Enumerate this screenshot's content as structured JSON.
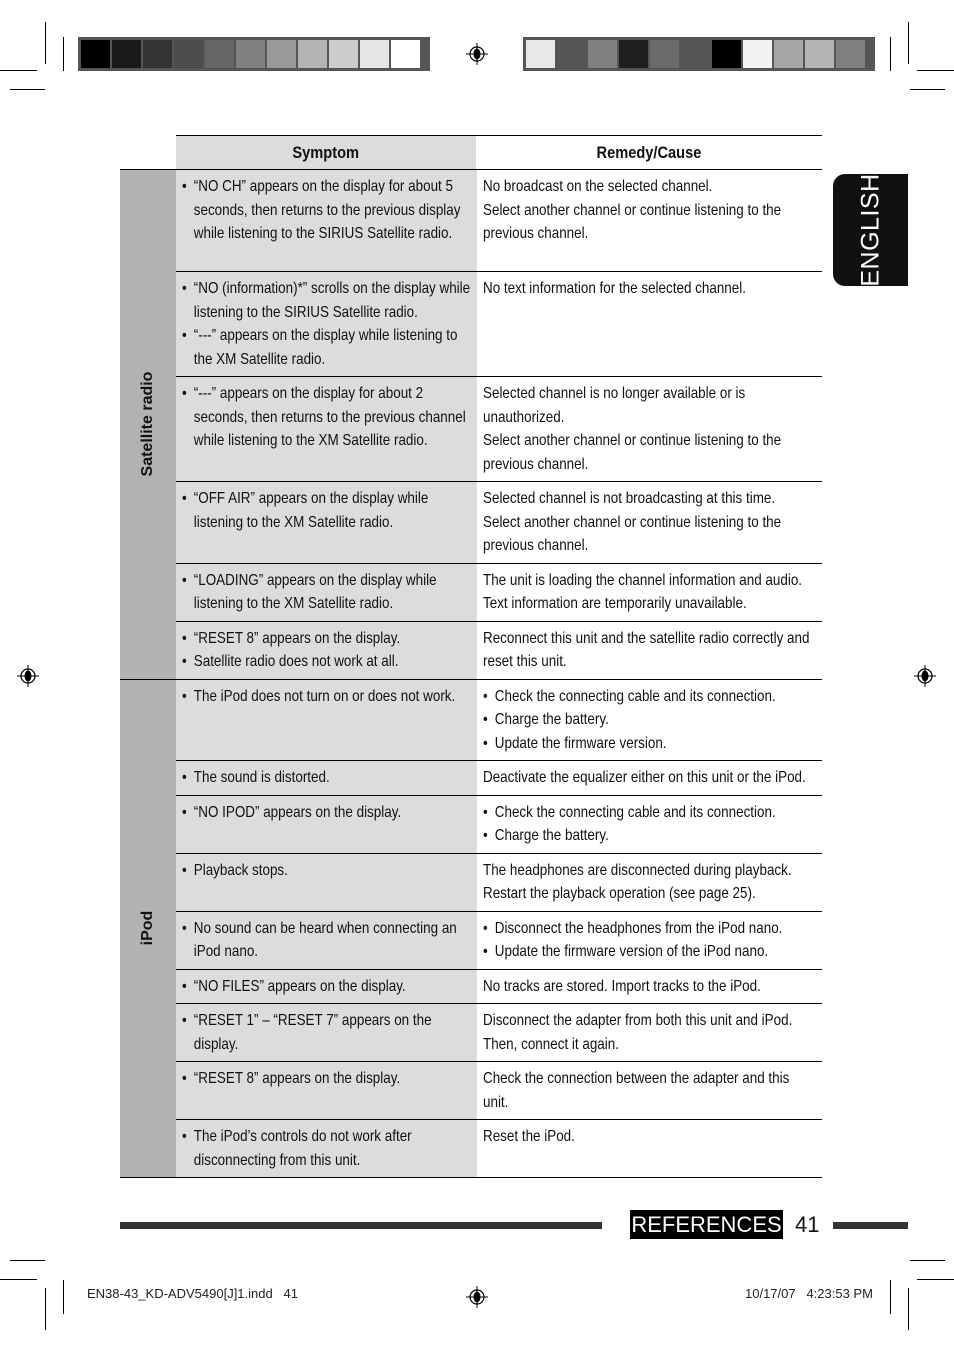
{
  "language_tab": "ENGLISH",
  "table": {
    "headers": {
      "symptom": "Symptom",
      "remedy": "Remedy/Cause"
    },
    "groups": [
      {
        "category": "Satellite radio",
        "rows": [
          {
            "symptom": [
              "“NO CH” appears on the display for about 5 seconds, then returns to the previous display while listening to the SIRIUS Satellite radio."
            ],
            "remedy": {
              "bulleted": false,
              "lines": [
                "No broadcast on the selected channel.",
                "Select another channel or continue listening to the previous channel."
              ]
            }
          },
          {
            "symptom": [
              "“NO (information)*” scrolls on the display while listening to the SIRIUS Satellite radio.",
              "“---” appears on the display while listening to the XM Satellite radio."
            ],
            "remedy": {
              "bulleted": false,
              "lines": [
                "No text information for the selected channel."
              ]
            }
          },
          {
            "symptom": [
              "“---” appears on the display for about 2 seconds, then returns to the previous channel while listening to the XM Satellite radio."
            ],
            "remedy": {
              "bulleted": false,
              "lines": [
                "Selected channel is no longer available or is unauthorized.",
                "Select another channel or continue listening to the previous channel."
              ]
            }
          },
          {
            "symptom": [
              "“OFF AIR” appears on the display while listening to the XM Satellite radio."
            ],
            "remedy": {
              "bulleted": false,
              "lines": [
                "Selected channel is not broadcasting at this time.",
                "Select another channel or continue listening to the previous channel."
              ]
            }
          },
          {
            "symptom": [
              "“LOADING” appears on the display while listening to the XM Satellite radio."
            ],
            "remedy": {
              "bulleted": false,
              "lines": [
                "The unit is loading the channel information and audio.",
                "Text information are temporarily unavailable."
              ]
            }
          },
          {
            "symptom": [
              "“RESET 8” appears on the display.",
              "Satellite radio does not work at all."
            ],
            "remedy": {
              "bulleted": false,
              "lines": [
                "Reconnect this unit and the satellite radio correctly and reset this unit."
              ]
            }
          }
        ]
      },
      {
        "category": "iPod",
        "rows": [
          {
            "symptom": [
              "The iPod does not turn on or does not work."
            ],
            "remedy": {
              "bulleted": true,
              "lines": [
                "Check the connecting cable and its connection.",
                "Charge the battery.",
                "Update the firmware version."
              ]
            }
          },
          {
            "symptom": [
              "The sound is distorted."
            ],
            "remedy": {
              "bulleted": false,
              "lines": [
                "Deactivate the equalizer either on this unit or the iPod."
              ]
            }
          },
          {
            "symptom": [
              "“NO IPOD” appears on the display."
            ],
            "remedy": {
              "bulleted": true,
              "lines": [
                "Check the connecting cable and its connection.",
                "Charge the battery."
              ]
            }
          },
          {
            "symptom": [
              "Playback stops."
            ],
            "remedy": {
              "bulleted": false,
              "lines": [
                "The headphones are disconnected during playback.",
                "Restart the playback operation (see page 25)."
              ]
            }
          },
          {
            "symptom": [
              "No sound can be heard when connecting an iPod nano."
            ],
            "remedy": {
              "bulleted": true,
              "lines": [
                "Disconnect the headphones from the iPod nano.",
                "Update the firmware version of the iPod nano."
              ]
            }
          },
          {
            "symptom": [
              "“NO FILES” appears on the display."
            ],
            "remedy": {
              "bulleted": false,
              "lines": [
                "No tracks are stored. Import tracks to the iPod."
              ]
            }
          },
          {
            "symptom": [
              "“RESET 1” – “RESET 7” appears on the display."
            ],
            "remedy": {
              "bulleted": false,
              "lines": [
                "Disconnect the adapter from both this unit and iPod.",
                "Then, connect it again."
              ]
            }
          },
          {
            "symptom": [
              "“RESET 8” appears on the display."
            ],
            "remedy": {
              "bulleted": false,
              "lines": [
                "Check the connection between the adapter and this unit."
              ]
            }
          },
          {
            "symptom": [
              "The iPod’s controls do not work after disconnecting from this unit."
            ],
            "remedy": {
              "bulleted": false,
              "lines": [
                "Reset the iPod."
              ]
            }
          }
        ]
      }
    ]
  },
  "footer": {
    "section": "REFERENCES",
    "page_number": "41",
    "slug_file": "EN38-43_KD-ADV5490[J]1.indd   41",
    "slug_date": "10/17/07   4:23:53 PM"
  },
  "colorbars": {
    "left": [
      "#000000",
      "#1a1a1a",
      "#333333",
      "#4d4d4d",
      "#666666",
      "#808080",
      "#999999",
      "#b3b3b3",
      "#cccccc",
      "#e6e6e6",
      "#ffffff"
    ],
    "right": [
      "#e8e8e8",
      "#555555",
      "#808080",
      "#1e1e1e",
      "#6a6a6a",
      "#555555",
      "#000000",
      "#f2f2f2",
      "#a6a6a6",
      "#b3b3b3",
      "#7f7f7f"
    ]
  },
  "colors": {
    "symptom_bg": "#dcdcdc",
    "category_bg": "#b2b2b2",
    "tab_bg": "#111111"
  }
}
